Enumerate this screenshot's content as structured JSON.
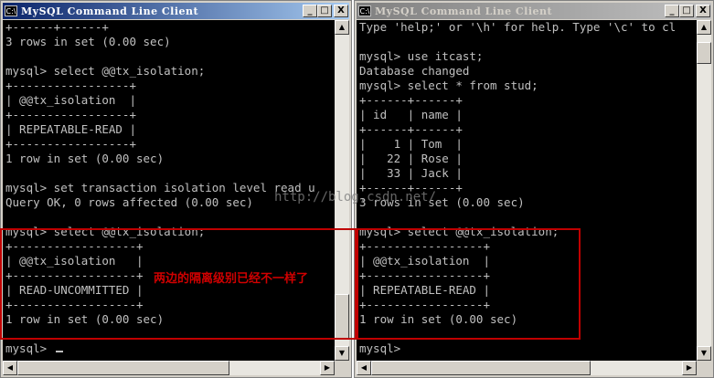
{
  "left_window": {
    "title": "MySQL Command Line Client",
    "icon_label": "C:\\",
    "buttons": {
      "minimize": "_",
      "maximize": "□",
      "close": "X"
    },
    "lines": [
      "+------+------+",
      "3 rows in set (0.00 sec)",
      "",
      "mysql> select @@tx_isolation;",
      "+-----------------+",
      "| @@tx_isolation  |",
      "+-----------------+",
      "| REPEATABLE-READ |",
      "+-----------------+",
      "1 row in set (0.00 sec)",
      "",
      "mysql> set transaction isolation level read u",
      "Query OK, 0 rows affected (0.00 sec)",
      "",
      "mysql> select @@tx_isolation;",
      "+------------------+",
      "| @@tx_isolation   |",
      "+------------------+",
      "| READ-UNCOMMITTED |",
      "+------------------+",
      "1 row in set (0.00 sec)",
      "",
      "mysql> "
    ]
  },
  "right_window": {
    "title": "MySQL Command Line Client",
    "icon_label": "C:\\",
    "buttons": {
      "minimize": "_",
      "maximize": "□",
      "close": "X"
    },
    "lines": [
      "Type 'help;' or '\\h' for help. Type '\\c' to cl",
      "",
      "mysql> use itcast;",
      "Database changed",
      "mysql> select * from stud;",
      "+------+------+",
      "| id   | name |",
      "+------+------+",
      "|    1 | Tom  |",
      "|   22 | Rose |",
      "|   33 | Jack |",
      "+------+------+",
      "3 rows in set (0.00 sec)",
      "",
      "mysql> select @@tx_isolation;",
      "+-----------------+",
      "| @@tx_isolation  |",
      "+-----------------+",
      "| REPEATABLE-READ |",
      "+-----------------+",
      "1 row in set (0.00 sec)",
      "",
      "mysql>"
    ]
  },
  "annotation": {
    "text": "两边的隔离级别已经不一样了",
    "color": "#d00000"
  },
  "watermark": "http://blog.csdn.net/"
}
